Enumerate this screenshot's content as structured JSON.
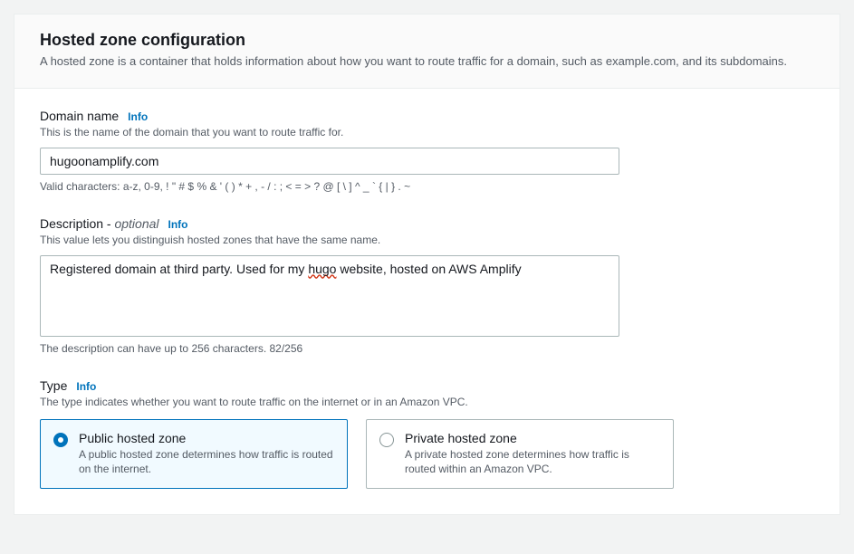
{
  "header": {
    "title": "Hosted zone configuration",
    "subtitle": "A hosted zone is a container that holds information about how you want to route traffic for a domain, such as example.com, and its subdomains."
  },
  "domain": {
    "label": "Domain name",
    "info": "Info",
    "hint": "This is the name of the domain that you want to route traffic for.",
    "value": "hugoonamplify.com",
    "constraint": "Valid characters: a-z, 0-9, ! \" # $ % & ' ( ) * + , - / : ; < = > ? @ [ \\ ] ^ _ ` { | } . ~"
  },
  "description": {
    "label_main": "Description - ",
    "label_optional": "optional",
    "info": "Info",
    "hint": "This value lets you distinguish hosted zones that have the same name.",
    "value_pre": "Registered domain at third party.  Used for my ",
    "value_spell": "hugo",
    "value_post": " website, hosted on AWS Amplify",
    "constraint": "The description can have up to 256 characters. 82/256"
  },
  "type": {
    "label": "Type",
    "info": "Info",
    "hint": "The type indicates whether you want to route traffic on the internet or in an Amazon VPC.",
    "options": {
      "public": {
        "title": "Public hosted zone",
        "desc": "A public hosted zone determines how traffic is routed on the internet."
      },
      "private": {
        "title": "Private hosted zone",
        "desc": "A private hosted zone determines how traffic is routed within an Amazon VPC."
      }
    }
  }
}
